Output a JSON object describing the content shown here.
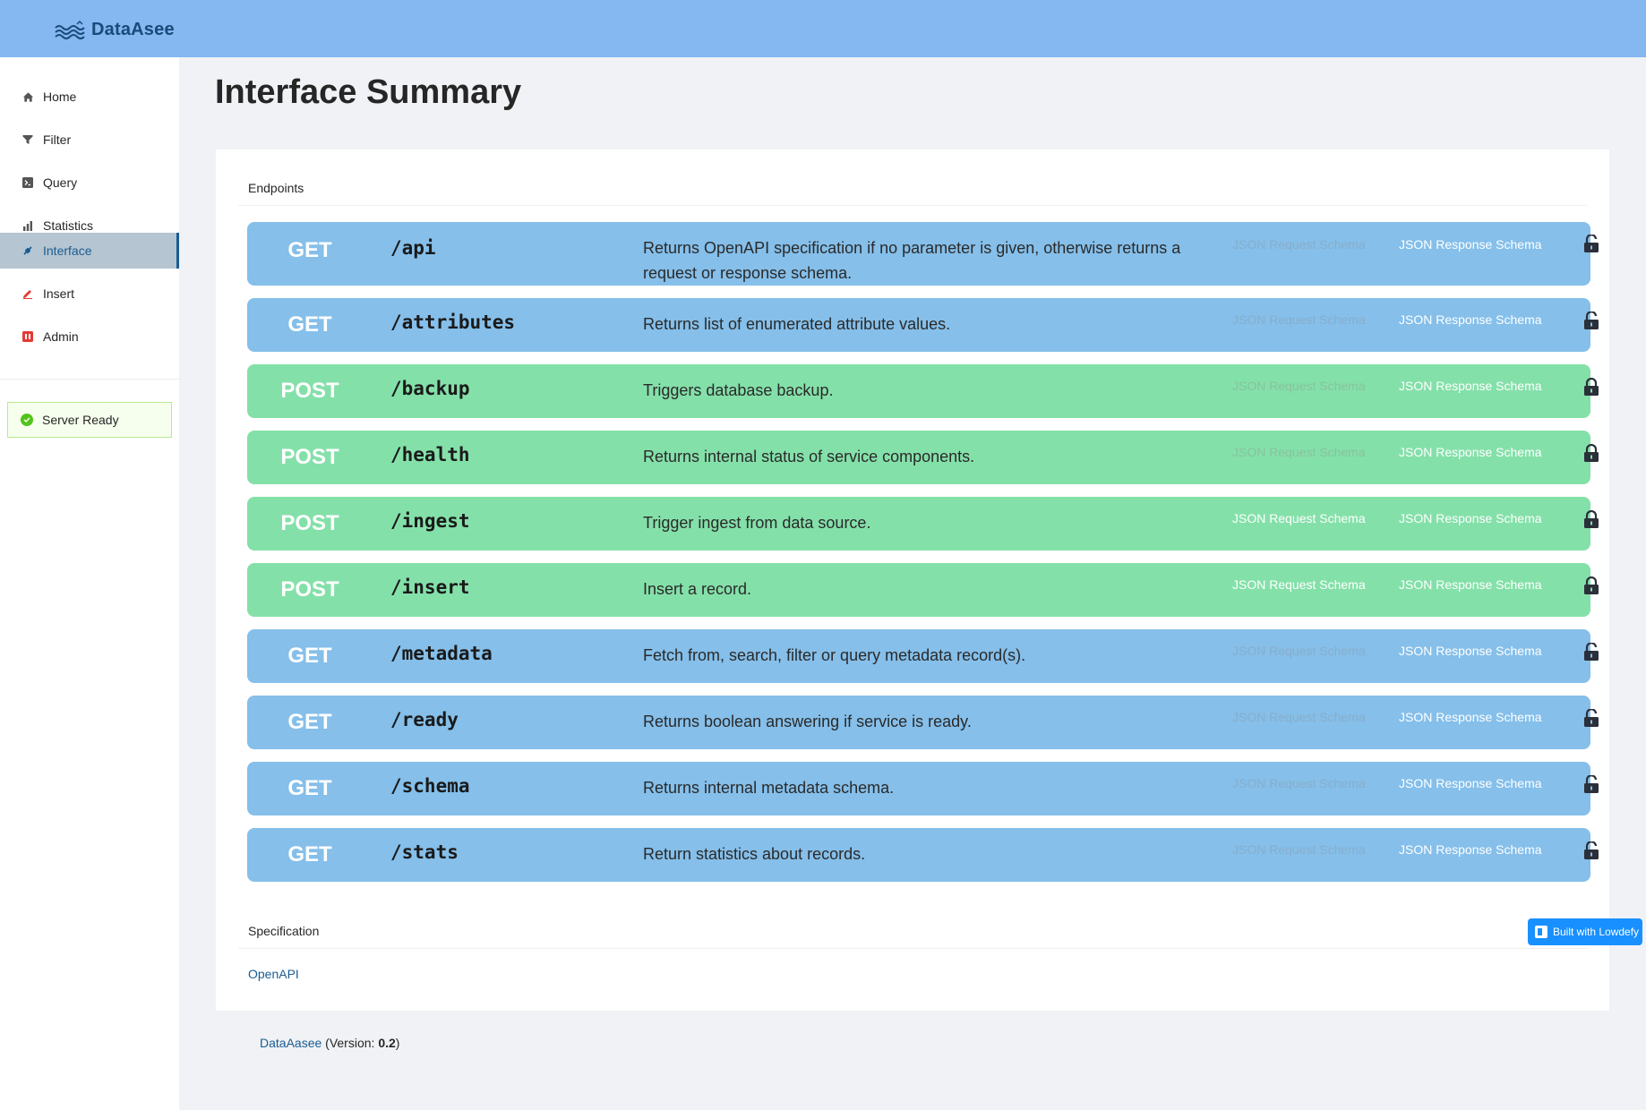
{
  "app": {
    "name": "DataAsee"
  },
  "sidebar": {
    "items": [
      {
        "label": "Home",
        "icon": "home-icon",
        "active": false
      },
      {
        "label": "Filter",
        "icon": "filter-icon",
        "active": false
      },
      {
        "label": "Query",
        "icon": "terminal-icon",
        "active": false
      },
      {
        "label": "Statistics",
        "icon": "bar-chart-icon",
        "active": false
      },
      {
        "label": "Interface",
        "icon": "api-icon",
        "active": true
      },
      {
        "label": "Insert",
        "icon": "edit-icon",
        "active": false
      },
      {
        "label": "Admin",
        "icon": "admin-icon",
        "active": false
      }
    ],
    "status": {
      "label": "Server Ready",
      "icon": "check-circle-icon",
      "color": "#52c41a"
    }
  },
  "page": {
    "title": "Interface Summary"
  },
  "endpoints_section": {
    "label": "Endpoints"
  },
  "endpoints": [
    {
      "method": "GET",
      "path": "/api",
      "description": "Returns OpenAPI specification if no parameter is given, otherwise returns a request or response schema.",
      "request_schema": "JSON Request Schema",
      "request_enabled": false,
      "response_schema": "JSON Response Schema",
      "lock": "unlocked"
    },
    {
      "method": "GET",
      "path": "/attributes",
      "description": "Returns list of enumerated attribute values.",
      "request_schema": "JSON Request Schema",
      "request_enabled": false,
      "response_schema": "JSON Response Schema",
      "lock": "unlocked"
    },
    {
      "method": "POST",
      "path": "/backup",
      "description": "Triggers database backup.",
      "request_schema": "JSON Request Schema",
      "request_enabled": false,
      "response_schema": "JSON Response Schema",
      "lock": "locked"
    },
    {
      "method": "POST",
      "path": "/health",
      "description": "Returns internal status of service components.",
      "request_schema": "JSON Request Schema",
      "request_enabled": false,
      "response_schema": "JSON Response Schema",
      "lock": "locked"
    },
    {
      "method": "POST",
      "path": "/ingest",
      "description": "Trigger ingest from data source.",
      "request_schema": "JSON Request Schema",
      "request_enabled": true,
      "response_schema": "JSON Response Schema",
      "lock": "locked"
    },
    {
      "method": "POST",
      "path": "/insert",
      "description": "Insert a record.",
      "request_schema": "JSON Request Schema",
      "request_enabled": true,
      "response_schema": "JSON Response Schema",
      "lock": "locked"
    },
    {
      "method": "GET",
      "path": "/metadata",
      "description": "Fetch from, search, filter or query metadata record(s).",
      "request_schema": "JSON Request Schema",
      "request_enabled": false,
      "response_schema": "JSON Response Schema",
      "lock": "unlocked"
    },
    {
      "method": "GET",
      "path": "/ready",
      "description": "Returns boolean answering if service is ready.",
      "request_schema": "JSON Request Schema",
      "request_enabled": false,
      "response_schema": "JSON Response Schema",
      "lock": "unlocked"
    },
    {
      "method": "GET",
      "path": "/schema",
      "description": "Returns internal metadata schema.",
      "request_schema": "JSON Request Schema",
      "request_enabled": false,
      "response_schema": "JSON Response Schema",
      "lock": "unlocked"
    },
    {
      "method": "GET",
      "path": "/stats",
      "description": "Return statistics about records.",
      "request_schema": "JSON Request Schema",
      "request_enabled": false,
      "response_schema": "JSON Response Schema",
      "lock": "unlocked"
    }
  ],
  "specification_section": {
    "label": "Specification",
    "link": "OpenAPI"
  },
  "footer": {
    "brand": "DataAasee",
    "version_prefix": " (Version: ",
    "version": "0.2",
    "version_suffix": ")"
  },
  "badge": {
    "label": "Built with Lowdefy"
  },
  "colors": {
    "get": "#85bfea",
    "post": "#84e0a9",
    "accent": "#1a5c91",
    "header": "#85b7f1"
  }
}
